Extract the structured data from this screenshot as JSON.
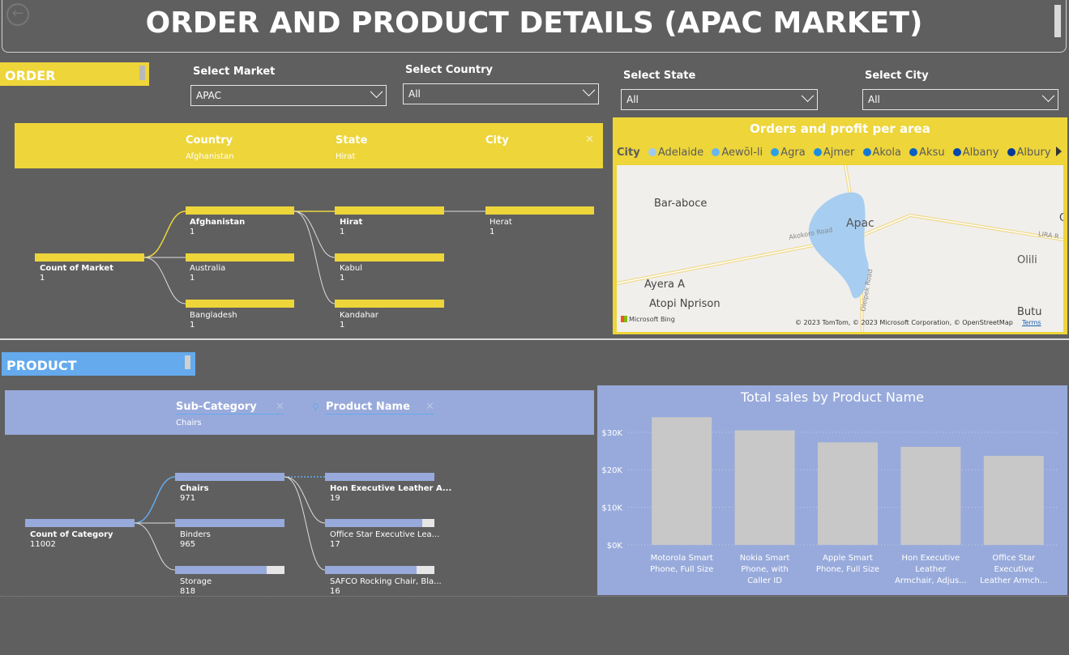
{
  "header": {
    "title": "ORDER AND PRODUCT DETAILS (APAC MARKET)"
  },
  "order": {
    "tag": "ORDER"
  },
  "product": {
    "tag": "PRODUCT"
  },
  "slicers": {
    "market": {
      "label": "Select Market",
      "value": "APAC"
    },
    "country": {
      "label": "Select Country",
      "value": "All"
    },
    "state": {
      "label": "Select State",
      "value": "All"
    },
    "city": {
      "label": "Select City",
      "value": "All"
    }
  },
  "order_tree": {
    "columns": [
      {
        "title": "Country",
        "value": "Afghanistan"
      },
      {
        "title": "State",
        "value": "Hirat"
      },
      {
        "title": "City",
        "value": ""
      }
    ],
    "root": {
      "label": "Count of Market",
      "value": "1"
    },
    "level1": [
      {
        "label": "Afghanistan",
        "value": "1"
      },
      {
        "label": "Australia",
        "value": "1"
      },
      {
        "label": "Bangladesh",
        "value": "1"
      }
    ],
    "level2": [
      {
        "label": "Hirat",
        "value": "1"
      },
      {
        "label": "Kabul",
        "value": "1"
      },
      {
        "label": "Kandahar",
        "value": "1"
      }
    ],
    "level3": [
      {
        "label": "Herat",
        "value": "1"
      }
    ]
  },
  "product_tree": {
    "columns": [
      {
        "title": "Sub-Category",
        "value": "Chairs"
      },
      {
        "title": "Product Name",
        "value": ""
      }
    ],
    "root": {
      "label": "Count of Category",
      "value": "11002"
    },
    "level1": [
      {
        "label": "Chairs",
        "value": "971",
        "fill": 1.0
      },
      {
        "label": "Binders",
        "value": "965",
        "fill": 1.0
      },
      {
        "label": "Storage",
        "value": "818",
        "fill": 0.84
      }
    ],
    "level2": [
      {
        "label": "Hon Executive Leather A...",
        "value": "19",
        "fill": 1.0
      },
      {
        "label": "Office Star Executive Lea...",
        "value": "17",
        "fill": 0.89
      },
      {
        "label": "SAFCO Rocking Chair, Bla...",
        "value": "16",
        "fill": 0.84
      }
    ]
  },
  "map": {
    "title": "Orders and profit per area",
    "legend_title": "City",
    "legend": [
      {
        "name": "Adelaide",
        "color": "#9fcbf1"
      },
      {
        "name": "Aewŏl-li",
        "color": "#6bb5ee"
      },
      {
        "name": "Agra",
        "color": "#2aa0e8"
      },
      {
        "name": "Ajmer",
        "color": "#1a8fe0"
      },
      {
        "name": "Akola",
        "color": "#1177d6"
      },
      {
        "name": "Aksu",
        "color": "#0b5fc6"
      },
      {
        "name": "Albany",
        "color": "#0747b0"
      },
      {
        "name": "Albury",
        "color": "#073a97"
      }
    ],
    "places": {
      "p1": "Bar-aboce",
      "p2": "Apac",
      "p3": "Olili",
      "p4": "Ayera A",
      "p5": "Atopi Nprison",
      "p6": "Butu",
      "p7": "Akokoro Road",
      "p8": "LIRA R",
      "p9": "Olelpek Road",
      "p10": "O"
    },
    "brand": "Microsoft Bing",
    "copyright": "© 2023 TomTom, © 2023 Microsoft Corporation, © OpenStreetMap",
    "terms": "Terms"
  },
  "chart_data": {
    "type": "bar",
    "title": "Total sales by Product Name",
    "categories": [
      [
        "Motorola Smart",
        "Phone, Full Size"
      ],
      [
        "Nokia Smart",
        "Phone, with",
        "Caller ID"
      ],
      [
        "Apple Smart",
        "Phone, Full Size"
      ],
      [
        "Hon Executive",
        "Leather",
        "Armchair, Adjus..."
      ],
      [
        "Office Star",
        "Executive",
        "Leather Armch..."
      ]
    ],
    "values": [
      34000,
      30500,
      27300,
      26100,
      23700
    ],
    "ylim": [
      0,
      36000
    ],
    "yticks": [
      0,
      10000,
      20000,
      30000
    ],
    "ytick_labels": [
      "$0K",
      "$10K",
      "$20K",
      "$30K"
    ],
    "grid": true,
    "colors": {
      "bar": "#c8c8c8"
    }
  }
}
